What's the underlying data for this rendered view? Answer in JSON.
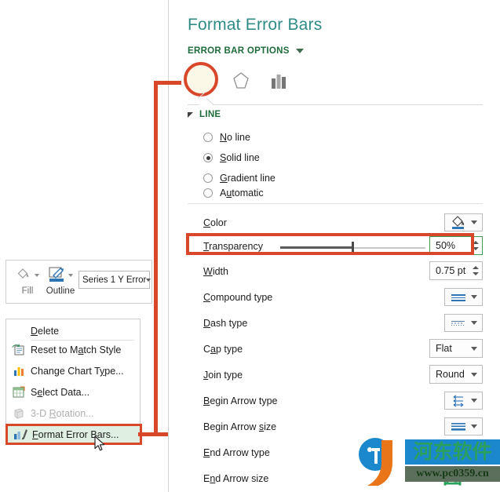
{
  "pane": {
    "title": "Format Error Bars",
    "options_label": "ERROR BAR OPTIONS",
    "tabs": [
      {
        "name": "fill-line",
        "icon": "paint-bucket-icon",
        "selected": true
      },
      {
        "name": "effects",
        "icon": "pentagon-icon",
        "selected": false
      },
      {
        "name": "size-properties",
        "icon": "bar-chart-icon",
        "selected": false
      }
    ],
    "section": {
      "header": "LINE",
      "radios": [
        {
          "label_pre": "",
          "accel": "N",
          "label_post": "o line",
          "full": "No line",
          "selected": false
        },
        {
          "label_pre": "",
          "accel": "S",
          "label_post": "olid line",
          "full": "Solid line",
          "selected": true
        },
        {
          "label_pre": "",
          "accel": "G",
          "label_post": "radient line",
          "full": "Gradient line",
          "selected": false
        },
        {
          "label_pre": "A",
          "accel": "u",
          "label_post": "tomatic",
          "full": "Automatic",
          "selected": false
        }
      ],
      "rows": [
        {
          "label_pre": "",
          "accel": "C",
          "label_post": "olor",
          "full": "Color",
          "control": "gallery",
          "icon": "fill-color-icon",
          "value": ""
        },
        {
          "label_pre": "",
          "accel": "T",
          "label_post": "ransparency",
          "full": "Transparency",
          "control": "slider-spinner",
          "value": "50%",
          "slider_percent": 50,
          "highlighted": true
        },
        {
          "label_pre": "",
          "accel": "W",
          "label_post": "idth",
          "full": "Width",
          "control": "spinner",
          "value": "0.75 pt"
        },
        {
          "label_pre": "",
          "accel": "C",
          "label_post": "ompound type",
          "full": "Compound type",
          "control": "gallery",
          "icon": "compound-line-icon",
          "value": ""
        },
        {
          "label_pre": "",
          "accel": "D",
          "label_post": "ash type",
          "full": "Dash type",
          "control": "gallery",
          "icon": "dash-line-icon",
          "value": ""
        },
        {
          "label_pre": "C",
          "accel": "a",
          "label_post": "p type",
          "full": "Cap type",
          "control": "combo",
          "value": "Flat"
        },
        {
          "label_pre": "",
          "accel": "J",
          "label_post": "oin type",
          "full": "Join type",
          "control": "combo",
          "value": "Round"
        },
        {
          "label_pre": "",
          "accel": "B",
          "label_post": "egin Arrow type",
          "full": "Begin Arrow type",
          "control": "gallery",
          "icon": "begin-arrow-type-icon",
          "value": ""
        },
        {
          "label_pre": "Begin Arrow ",
          "accel": "s",
          "label_post": "ize",
          "full": "Begin Arrow size",
          "control": "gallery",
          "icon": "begin-arrow-size-icon",
          "value": ""
        },
        {
          "label_pre": "",
          "accel": "E",
          "label_post": "nd Arrow type",
          "full": "End Arrow type",
          "control": "gallery",
          "icon": "end-arrow-type-icon",
          "value": ""
        },
        {
          "label_pre": "E",
          "accel": "n",
          "label_post": "d Arrow size",
          "full": "End Arrow size",
          "control": "none",
          "value": ""
        }
      ]
    }
  },
  "mini_toolbar": {
    "fill_label": "Fill",
    "outline_label": "Outline",
    "series_value": "Series 1 Y Error"
  },
  "context_menu": {
    "items": [
      {
        "label_pre": "",
        "accel": "D",
        "label_post": "elete",
        "full": "Delete",
        "icon": "",
        "disabled": false,
        "highlighted": false
      },
      {
        "label_pre": "Reset to M",
        "accel": "a",
        "label_post": "tch Style",
        "full": "Reset to Match Style",
        "icon": "reset-style-icon",
        "disabled": false,
        "highlighted": false
      },
      {
        "label_pre": "Change Chart T",
        "accel": "y",
        "label_post": "pe...",
        "full": "Change Chart Type...",
        "icon": "change-chart-type-icon",
        "disabled": false,
        "highlighted": false
      },
      {
        "label_pre": "S",
        "accel": "e",
        "label_post": "lect Data...",
        "full": "Select Data...",
        "icon": "select-data-icon",
        "disabled": false,
        "highlighted": false
      },
      {
        "label_pre": "3-D ",
        "accel": "R",
        "label_post": "otation...",
        "full": "3-D Rotation...",
        "icon": "rotation-3d-icon",
        "disabled": true,
        "highlighted": false
      },
      {
        "label_pre": "",
        "accel": "F",
        "label_post": "ormat Error Bars...",
        "full": "Format Error Bars...",
        "icon": "format-error-bars-icon",
        "disabled": false,
        "highlighted": true
      }
    ]
  },
  "watermark": {
    "chinese": "河东软件园",
    "url": "www.pc0359.cn"
  },
  "colors": {
    "annotation": "#d9472b",
    "title": "#2e8b86",
    "section_header": "#1e6b3a",
    "highlight_bg": "#dff0e2",
    "accent_blue": "#2e75b6"
  }
}
